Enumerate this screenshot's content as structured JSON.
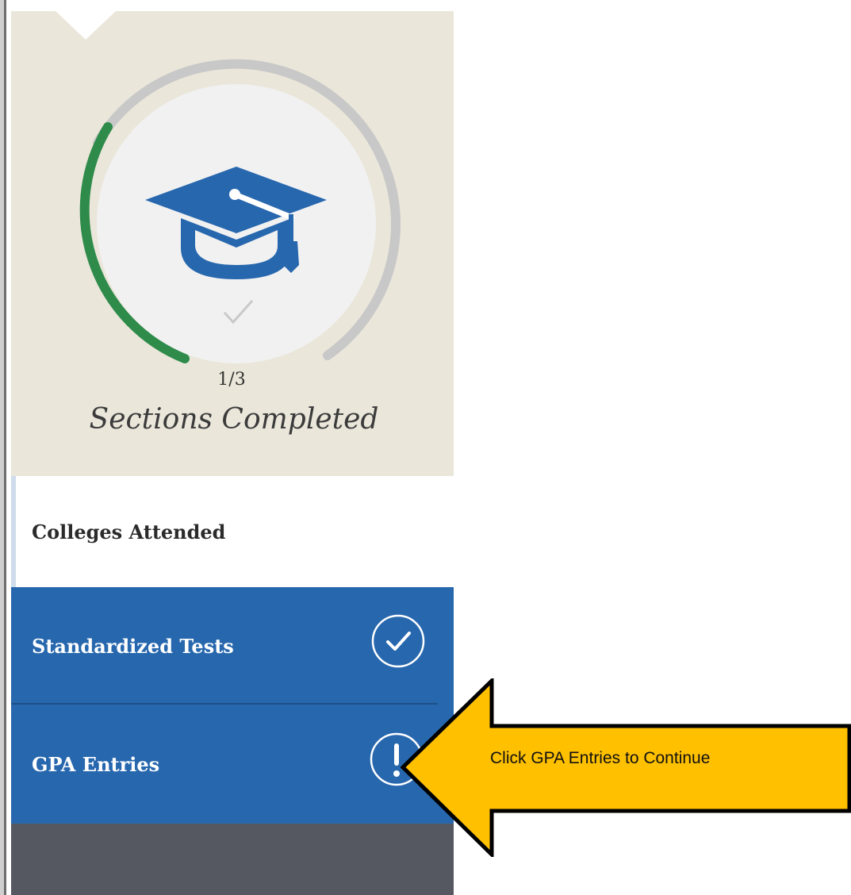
{
  "progress": {
    "completed": 1,
    "total": 3,
    "count_text": "1/3",
    "label": "Sections Completed",
    "fraction": 0.3333,
    "icon": "graduation-cap-icon"
  },
  "nav": {
    "items": [
      {
        "label": "Colleges Attended",
        "status": "none"
      },
      {
        "label": "Standardized Tests",
        "status": "complete",
        "icon": "check-circle-icon"
      },
      {
        "label": "GPA Entries",
        "status": "warning",
        "icon": "exclamation-circle-icon"
      }
    ]
  },
  "callout": {
    "text": "Click GPA Entries to Continue",
    "direction": "left",
    "color": "#ffc000"
  },
  "colors": {
    "panel_bg": "#eae6da",
    "nav_active_bg": "#2767ae",
    "progress_green": "#2e8b4a",
    "progress_track": "#c8c8c8",
    "cap_blue": "#2767ae",
    "footer_dark": "#555860"
  }
}
